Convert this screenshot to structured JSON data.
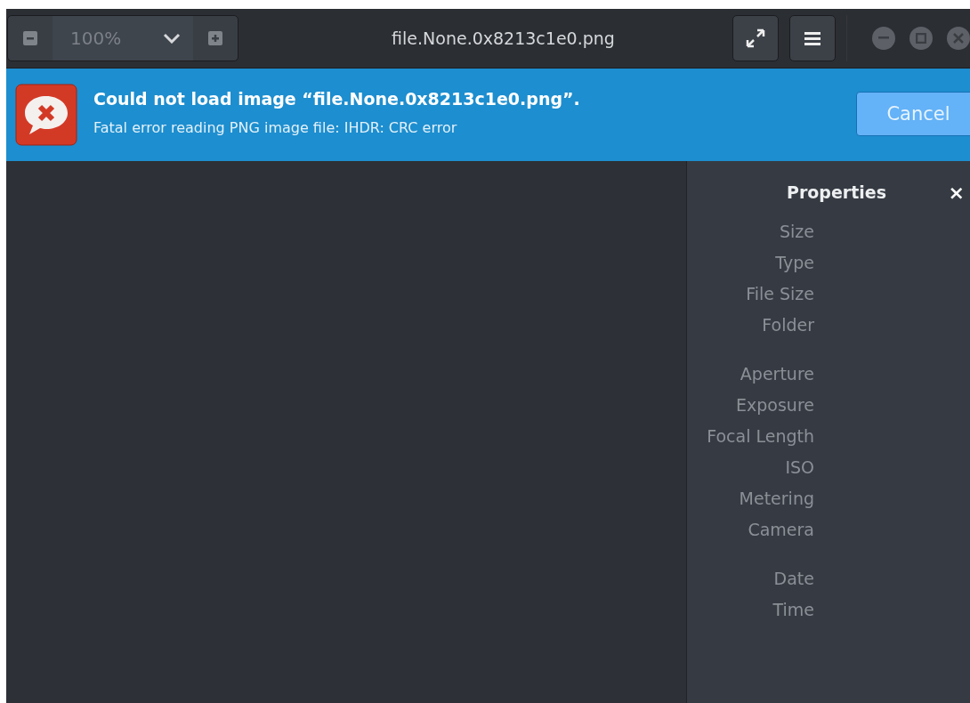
{
  "header": {
    "zoom": "100%",
    "title": "file.None.0x8213c1e0.png"
  },
  "banner": {
    "title": "Could not load image “file.None.0x8213c1e0.png”.",
    "message": "Fatal error reading PNG image file: IHDR: CRC error",
    "button": "Cancel"
  },
  "properties": {
    "title": "Properties",
    "close": "×",
    "groups": [
      {
        "labels": [
          "Size",
          "Type",
          "File Size",
          "Folder"
        ]
      },
      {
        "labels": [
          "Aperture",
          "Exposure",
          "Focal Length",
          "ISO",
          "Metering",
          "Camera"
        ]
      },
      {
        "labels": [
          "Date",
          "Time"
        ]
      }
    ]
  }
}
